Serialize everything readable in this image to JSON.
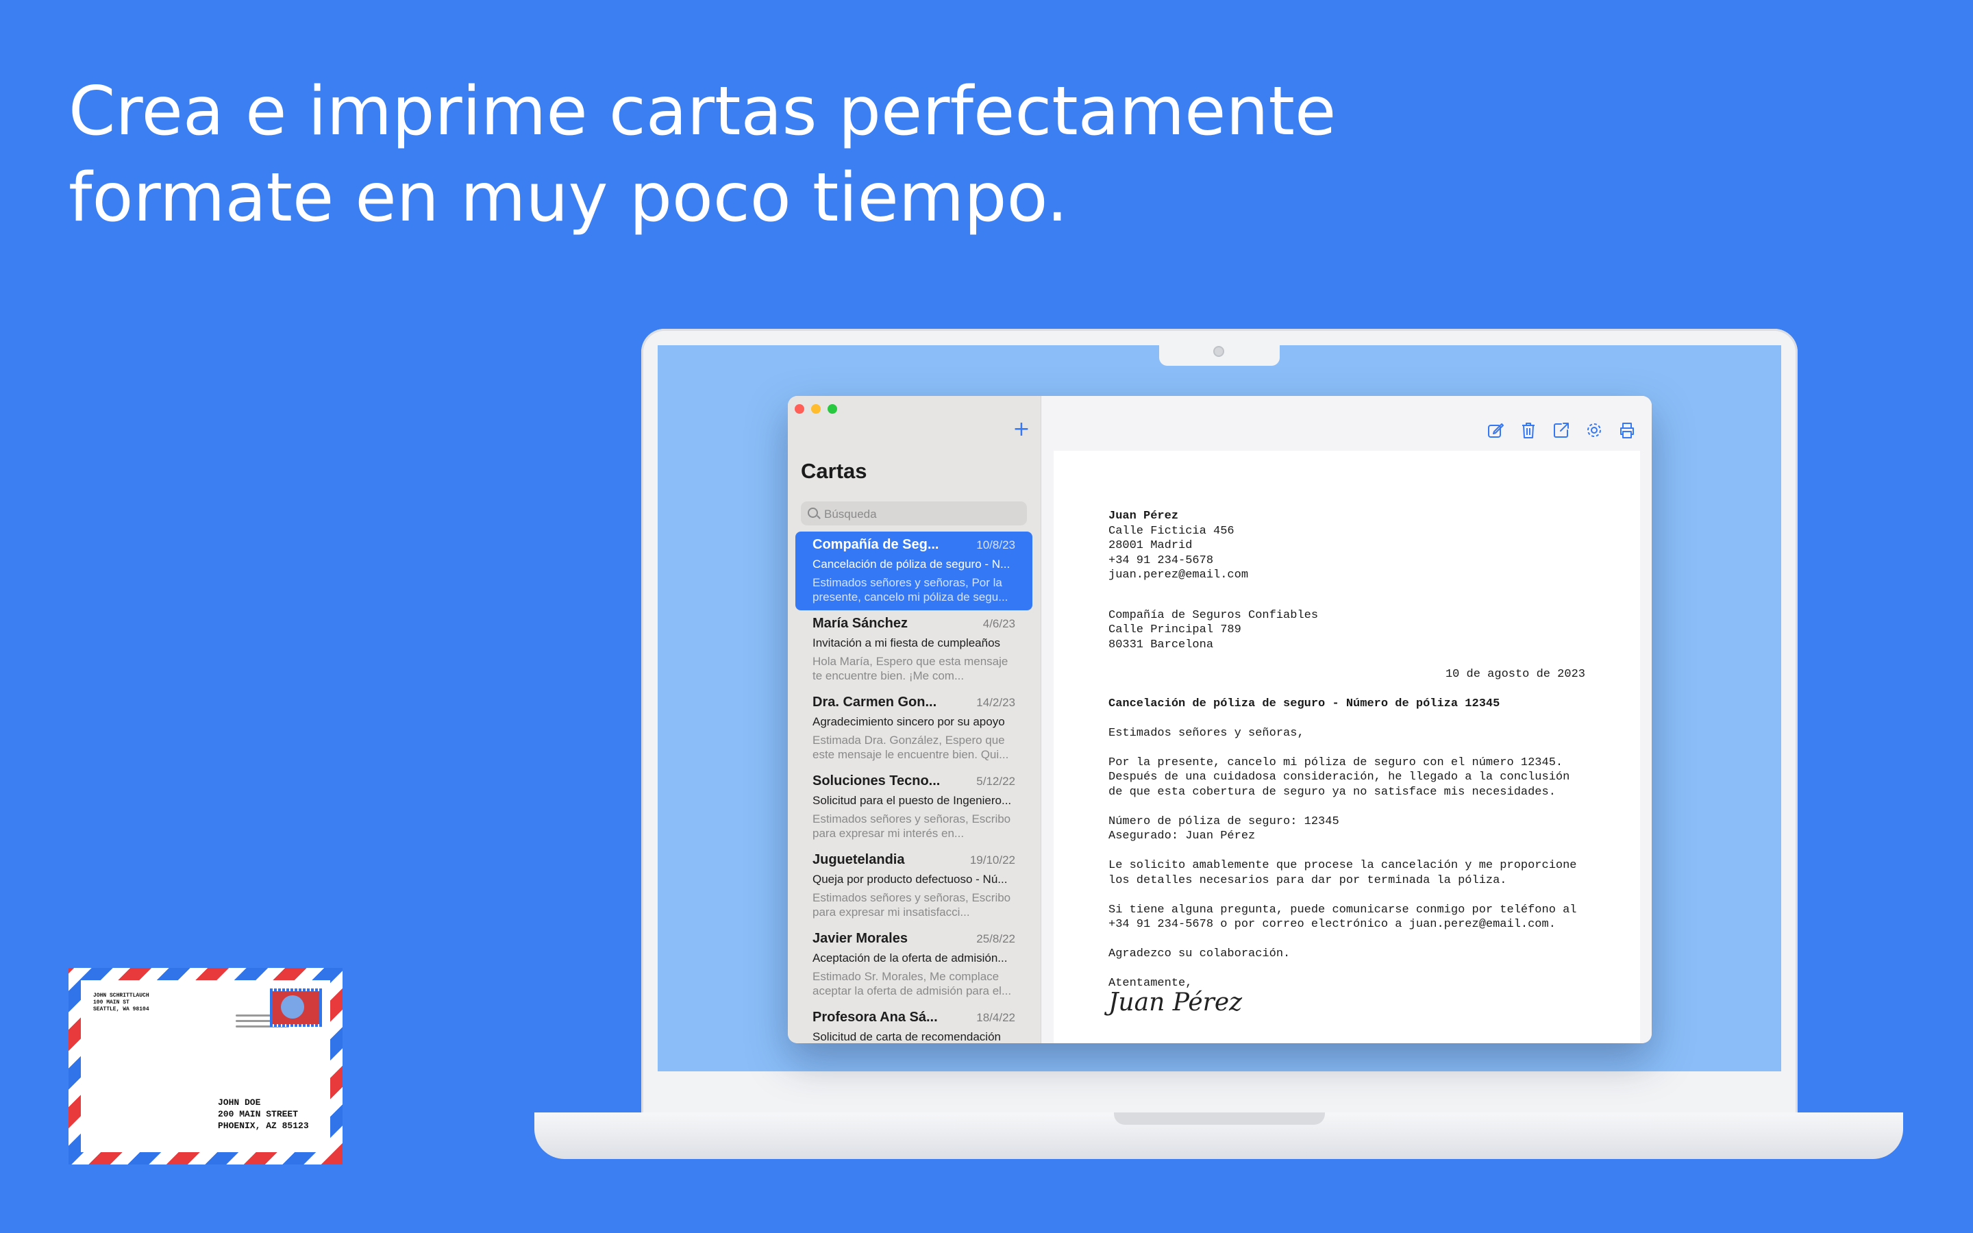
{
  "headline": {
    "line1": "Crea e imprime cartas perfectamente",
    "line2": "formate en muy poco tiempo."
  },
  "envelope": {
    "from": [
      "JOHN SCHRITTLAUCH",
      "100 MAIN ST",
      "SEATTLE, WA 98104"
    ],
    "to": [
      "JOHN DOE",
      "200 MAIN STREET",
      "PHOENIX, AZ 85123"
    ]
  },
  "sidebar": {
    "title": "Cartas",
    "add_label": "+",
    "search_placeholder": "Búsqueda",
    "items": [
      {
        "name": "Compañía de Seg...",
        "date": "10/8/23",
        "subject": "Cancelación de póliza de seguro - N...",
        "preview": "Estimados señores y señoras,  Por la presente, cancelo mi póliza de segu..."
      },
      {
        "name": "María Sánchez",
        "date": "4/6/23",
        "subject": "Invitación a mi fiesta de cumpleaños",
        "preview": "Hola María,  Espero que esta mensaje te encuentre bien. ¡Me com..."
      },
      {
        "name": "Dra. Carmen Gon...",
        "date": "14/2/23",
        "subject": "Agradecimiento sincero por su apoyo",
        "preview": "Estimada Dra. González,  Espero que este mensaje le encuentre bien. Qui..."
      },
      {
        "name": "Soluciones Tecno...",
        "date": "5/12/22",
        "subject": "Solicitud para el puesto de Ingeniero...",
        "preview": "Estimados señores y señoras, Escribo para expresar mi interés en..."
      },
      {
        "name": "Juguetelandia",
        "date": "19/10/22",
        "subject": "Queja por producto defectuoso - Nú...",
        "preview": "Estimados señores y señoras, Escribo para expresar mi insatisfacci..."
      },
      {
        "name": "Javier Morales",
        "date": "25/8/22",
        "subject": "Aceptación de la oferta de admisión...",
        "preview": "Estimado Sr. Morales,  Me complace aceptar la oferta de admisión para el..."
      },
      {
        "name": "Profesora Ana Sá...",
        "date": "18/4/22",
        "subject": "Solicitud de carta de recomendación",
        "preview": ""
      }
    ]
  },
  "toolbar": {
    "icons": [
      "compose-icon",
      "trash-icon",
      "share-icon",
      "gear-icon",
      "printer-icon"
    ]
  },
  "letter": {
    "sender": [
      "Juan Pérez",
      "Calle Ficticia 456",
      "28001 Madrid",
      "+34 91 234-5678",
      "juan.perez@email.com"
    ],
    "recipient": [
      "Compañía de Seguros Confiables",
      "Calle Principal 789",
      "80331 Barcelona"
    ],
    "date": "10 de agosto de 2023",
    "subject": "Cancelación de póliza de seguro - Número de póliza 12345",
    "greeting": "Estimados señores y señoras,",
    "para1": [
      "Por la presente, cancelo mi póliza de seguro con el número 12345.",
      "Después de una cuidadosa consideración, he llegado a la conclusión",
      "de que esta cobertura de seguro ya no satisface mis necesidades."
    ],
    "para2": [
      "Número de póliza de seguro: 12345",
      "Asegurado: Juan Pérez"
    ],
    "para3": [
      "Le solicito amablemente que procese la cancelación y me proporcione",
      "los detalles necesarios para dar por terminada la póliza."
    ],
    "para4": [
      "Si tiene alguna pregunta, puede comunicarse conmigo por teléfono al",
      "+34 91 234-5678 o por correo electrónico a juan.perez@email.com."
    ],
    "thanks": "Agradezco su colaboración.",
    "closing": "Atentamente,",
    "signature": "Juan Pérez"
  },
  "colors": {
    "background": "#3B7FF3",
    "accent": "#3478F6",
    "traffic_close": "#FF5F57",
    "traffic_minimize": "#FEBC2E",
    "traffic_zoom": "#28C840"
  }
}
